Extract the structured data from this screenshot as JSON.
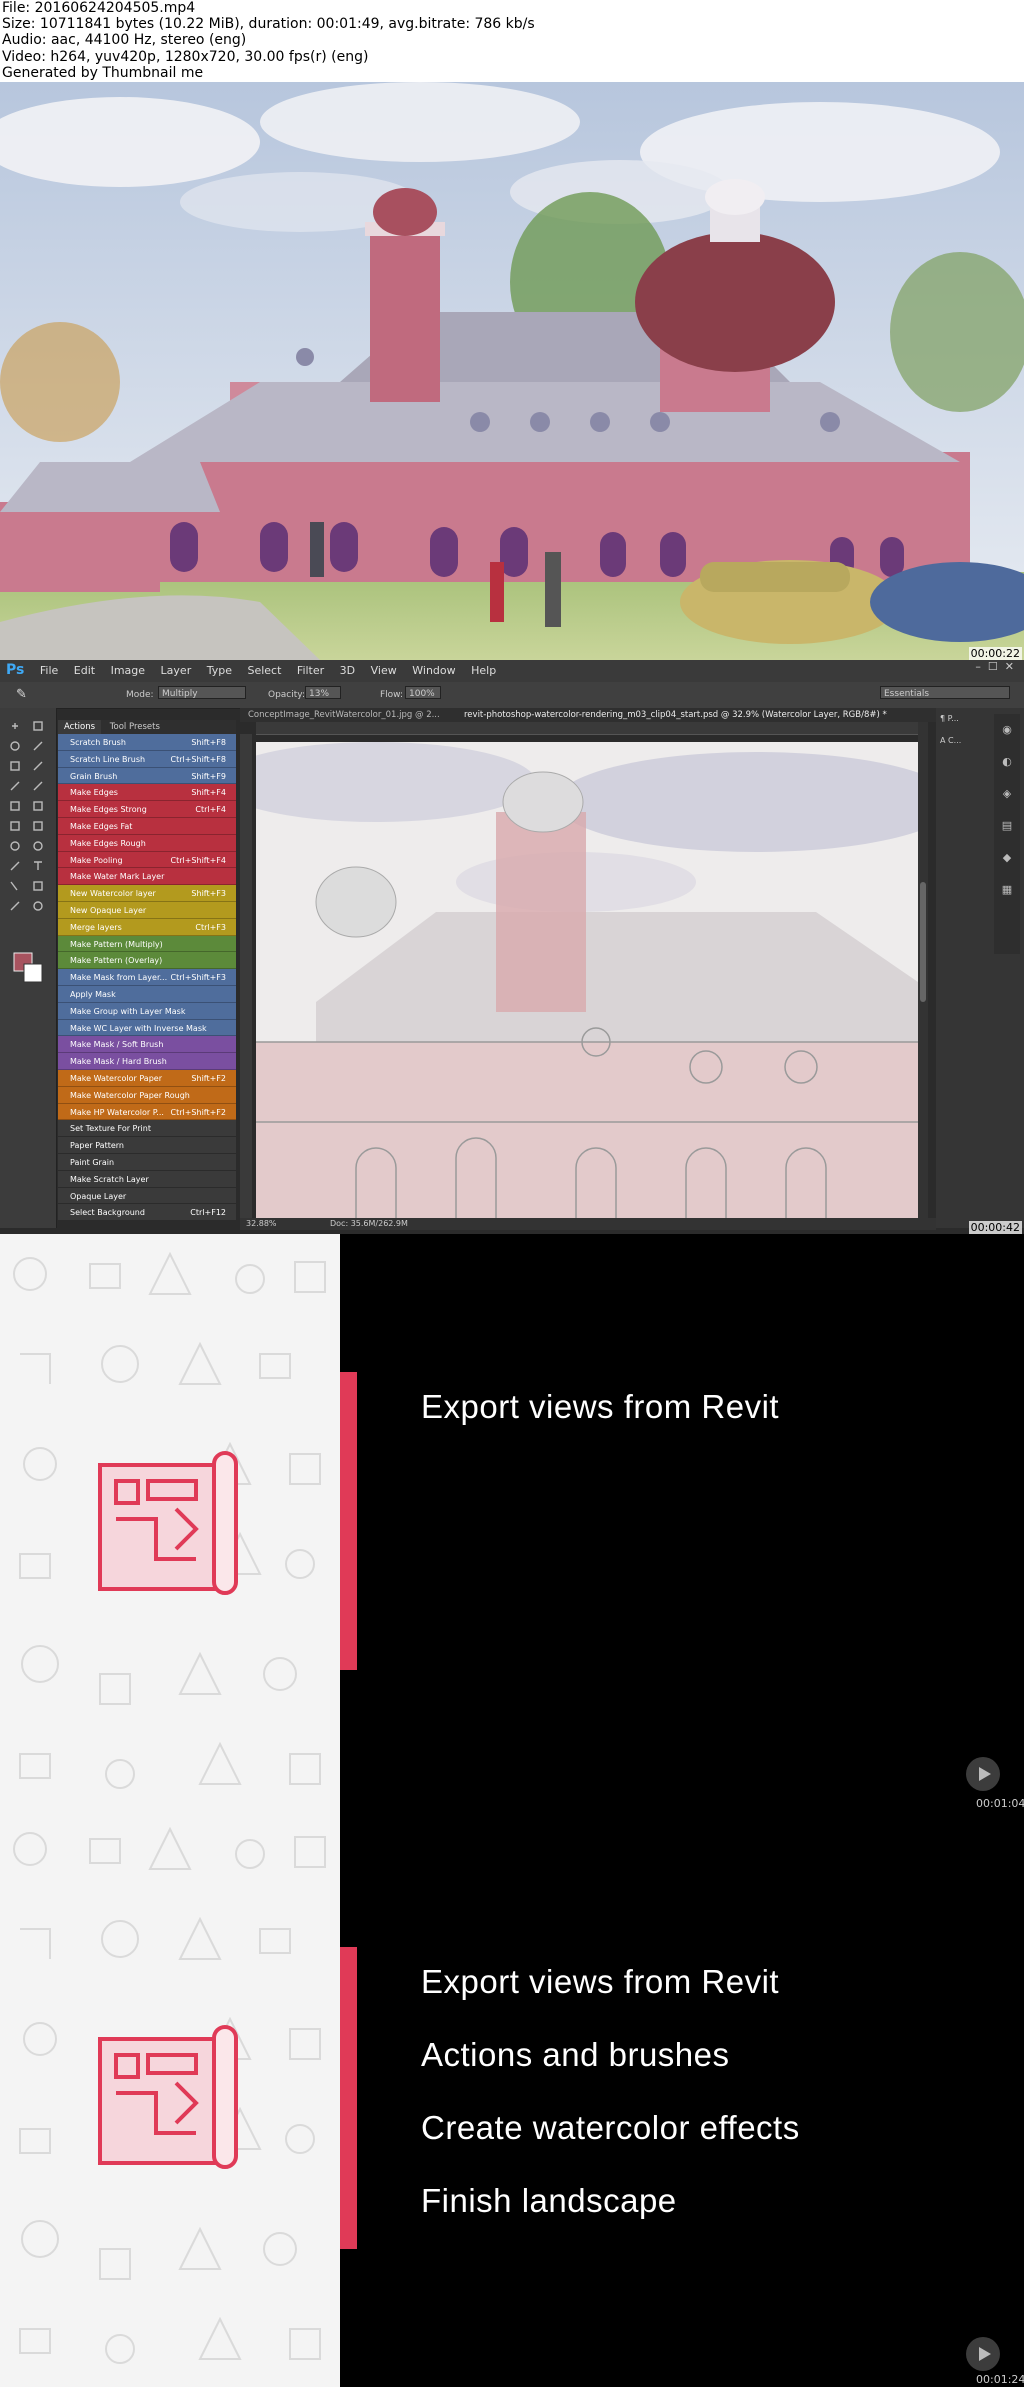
{
  "header": {
    "file": "File: 20160624204505.mp4",
    "size": "Size: 10711841 bytes (10.22 MiB), duration: 00:01:49, avg.bitrate: 786 kb/s",
    "audio": "Audio: aac, 44100 Hz, stereo (eng)",
    "video": "Video: h264, yuv420p, 1280x720, 30.00 fps(r) (eng)",
    "generated": "Generated by Thumbnail me"
  },
  "frames": [
    {
      "timestamp": "00:00:22"
    },
    {
      "timestamp": "00:00:42"
    },
    {
      "timestamp": "00:01:04"
    },
    {
      "timestamp": "00:01:24"
    }
  ],
  "photoshop": {
    "logo": "Ps",
    "menu": [
      "File",
      "Edit",
      "Image",
      "Layer",
      "Type",
      "Select",
      "Filter",
      "3D",
      "View",
      "Window",
      "Help"
    ],
    "options": {
      "mode_label": "Mode:",
      "mode_value": "Multiply",
      "opacity_label": "Opacity:",
      "opacity_value": "13%",
      "flow_label": "Flow:",
      "flow_value": "100%",
      "workspace": "Essentials"
    },
    "panel_tabs": [
      "Actions",
      "Tool Presets"
    ],
    "actions": [
      {
        "name": "Scratch Brush",
        "shortcut": "Shift+F8",
        "color": "#4f6d9c"
      },
      {
        "name": "Scratch Line Brush",
        "shortcut": "Ctrl+Shift+F8",
        "color": "#4f6d9c"
      },
      {
        "name": "Grain Brush",
        "shortcut": "Shift+F9",
        "color": "#4f6d9c"
      },
      {
        "name": "Make Edges",
        "shortcut": "Shift+F4",
        "color": "#b8303f"
      },
      {
        "name": "Make Edges Strong",
        "shortcut": "Ctrl+F4",
        "color": "#b8303f"
      },
      {
        "name": "Make Edges Fat",
        "shortcut": "",
        "color": "#b8303f"
      },
      {
        "name": "Make Edges Rough",
        "shortcut": "",
        "color": "#b8303f"
      },
      {
        "name": "Make Pooling",
        "shortcut": "Ctrl+Shift+F4",
        "color": "#b8303f"
      },
      {
        "name": "Make Water Mark Layer",
        "shortcut": "",
        "color": "#b8303f"
      },
      {
        "name": "New Watercolor layer",
        "shortcut": "Shift+F3",
        "color": "#b39a1e"
      },
      {
        "name": "New Opaque Layer",
        "shortcut": "",
        "color": "#b39a1e"
      },
      {
        "name": "Merge layers",
        "shortcut": "Ctrl+F3",
        "color": "#b39a1e"
      },
      {
        "name": "Make Pattern (Multiply)",
        "shortcut": "",
        "color": "#5c8a3a"
      },
      {
        "name": "Make Pattern (Overlay)",
        "shortcut": "",
        "color": "#5c8a3a"
      },
      {
        "name": "Make Mask from Layer...",
        "shortcut": "Ctrl+Shift+F3",
        "color": "#4f6d9c"
      },
      {
        "name": "Apply Mask",
        "shortcut": "",
        "color": "#4f6d9c"
      },
      {
        "name": "Make Group with Layer Mask",
        "shortcut": "",
        "color": "#4f6d9c"
      },
      {
        "name": "Make WC Layer with Inverse Mask",
        "shortcut": "",
        "color": "#4f6d9c"
      },
      {
        "name": "Make Mask / Soft Brush",
        "shortcut": "",
        "color": "#7a4fa0"
      },
      {
        "name": "Make Mask / Hard Brush",
        "shortcut": "",
        "color": "#7a4fa0"
      },
      {
        "name": "Make Watercolor Paper",
        "shortcut": "Shift+F2",
        "color": "#c06a18"
      },
      {
        "name": "Make Watercolor Paper Rough",
        "shortcut": "",
        "color": "#c06a18"
      },
      {
        "name": "Make HP Watercolor P...",
        "shortcut": "Ctrl+Shift+F2",
        "color": "#c06a18"
      },
      {
        "name": "Set Texture For Print",
        "shortcut": "",
        "color": "#3a3a3a"
      },
      {
        "name": "Paper Pattern",
        "shortcut": "",
        "color": "#3a3a3a"
      },
      {
        "name": "Paint Grain",
        "shortcut": "",
        "color": "#3a3a3a"
      },
      {
        "name": "Make Scratch Layer",
        "shortcut": "",
        "color": "#3a3a3a"
      },
      {
        "name": "Opaque Layer",
        "shortcut": "",
        "color": "#3a3a3a"
      },
      {
        "name": "Select Background",
        "shortcut": "Ctrl+F12",
        "color": "#3a3a3a"
      }
    ],
    "doc_tabs": [
      "ConceptImage_RevitWatercolor_01.jpg @ 2...",
      "revit-photoshop-watercolor-rendering_m03_clip04_start.psd @ 32.9% (Watercolor Layer, RGB/8#) *"
    ],
    "status_zoom": "32.88%",
    "status_doc": "Doc: 35.6M/262.9M",
    "layers_short": [
      "P...",
      "C..."
    ]
  },
  "slides": {
    "slide1_bullets": [
      "Export views from Revit"
    ],
    "slide2_bullets": [
      "Export views from Revit",
      "Actions and brushes",
      "Create watercolor effects",
      "Finish landscape"
    ]
  }
}
